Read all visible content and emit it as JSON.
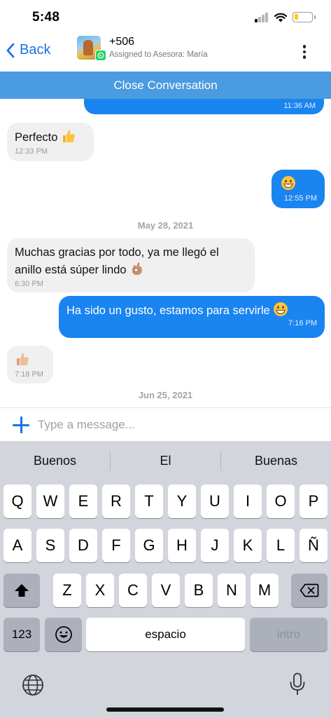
{
  "status_bar": {
    "time": "5:48"
  },
  "header": {
    "back_label": "Back",
    "contact_name": "+506",
    "assigned_text": "Assigned to Asesora: María"
  },
  "close_bar": {
    "label": "Close Conversation"
  },
  "messages": [
    {
      "dir": "out",
      "text": "",
      "time": "11:36 AM"
    },
    {
      "dir": "in",
      "text": "Perfecto",
      "emoji": "thumbs-up",
      "time": "12:33 PM"
    },
    {
      "dir": "out",
      "text": "",
      "emoji": "grinning-face",
      "time": "12:55 PM"
    },
    {
      "dir": "in",
      "text_line1": "Muchas gracias por todo, ya me llegó el",
      "text_line2": "anillo está súper lindo",
      "emoji": "ok-hand",
      "time": "6:30 PM"
    },
    {
      "dir": "out",
      "text": "Ha sido un gusto, estamos para servirle",
      "emoji": "grinning-face",
      "time": "7:16 PM"
    },
    {
      "dir": "in",
      "text": "",
      "emoji": "thumbs-up",
      "time": "7:18 PM"
    }
  ],
  "date_separators": [
    "May 28, 2021",
    "Jun 25, 2021"
  ],
  "composer": {
    "placeholder": "Type a message..."
  },
  "keyboard": {
    "suggestions": [
      "Buenos",
      "El",
      "Buenas"
    ],
    "row1": [
      "Q",
      "W",
      "E",
      "R",
      "T",
      "Y",
      "U",
      "I",
      "O",
      "P"
    ],
    "row2": [
      "A",
      "S",
      "D",
      "F",
      "G",
      "H",
      "J",
      "K",
      "L",
      "Ñ"
    ],
    "row3": [
      "Z",
      "X",
      "C",
      "V",
      "B",
      "N",
      "M"
    ],
    "numbers_label": "123",
    "space_label": "espacio",
    "return_label": "intro"
  },
  "colors": {
    "accent": "#1a73e8",
    "close_bar": "#4a9be0",
    "outgoing_bubble": "#1a84f0",
    "incoming_bubble": "#f0f0f0",
    "whatsapp": "#25d366"
  }
}
